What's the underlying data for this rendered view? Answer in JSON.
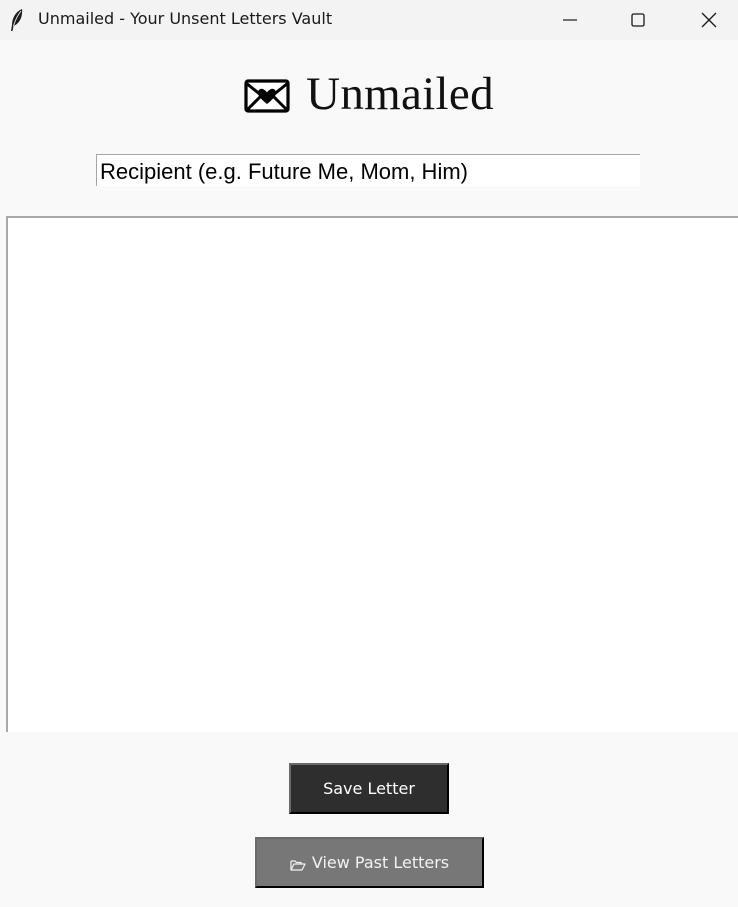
{
  "window": {
    "title": "Unmailed - Your Unsent Letters Vault",
    "icons": {
      "app": "feather-quill-icon",
      "minimize": "minimize-icon",
      "maximize": "maximize-icon",
      "close": "close-icon"
    }
  },
  "header": {
    "icon": "love-letter-envelope-icon",
    "title": "Unmailed"
  },
  "form": {
    "recipient_value": "Recipient (e.g. Future Me, Mom, Him)",
    "letter_body": ""
  },
  "actions": {
    "save_label": "Save Letter",
    "view_label": "View Past Letters",
    "view_icon": "open-folder-icon",
    "save_bg": "#2e2e2e",
    "view_bg": "#777777"
  }
}
